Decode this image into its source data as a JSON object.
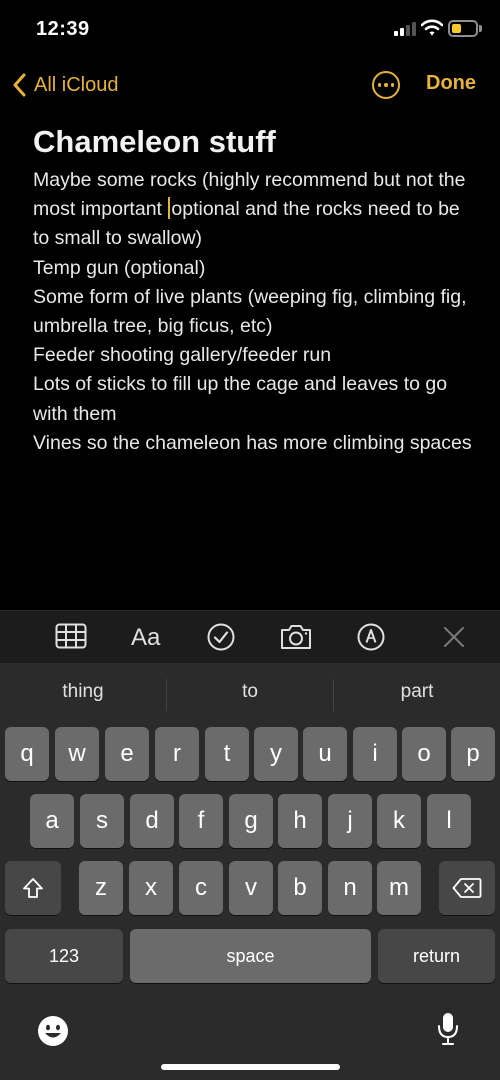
{
  "status": {
    "time": "12:39",
    "battery_level": 0.3
  },
  "nav": {
    "back_label": "All iCloud",
    "done_label": "Done"
  },
  "note": {
    "title": "Chameleon stuff",
    "line1_before_cursor": "Maybe some rocks (highly recommend but not the most important ",
    "line1_after_cursor": "optional and the rocks need to be to small to swallow)",
    "items": [
      "Temp gun (optional)",
      "Some form of live plants (weeping fig, climbing fig, umbrella tree, big ficus, etc)",
      "Feeder shooting gallery/feeder run",
      "Lots of sticks to fill up the cage and leaves to go with them",
      "Vines so the chameleon has more climbing spaces"
    ]
  },
  "toolbar": {
    "format_label": "Aa",
    "icons": [
      "table-icon",
      "format-icon",
      "checklist-icon",
      "camera-icon",
      "markup-icon",
      "close-icon"
    ]
  },
  "keyboard": {
    "suggestions": [
      "thing",
      "to",
      "part"
    ],
    "row1": [
      "q",
      "w",
      "e",
      "r",
      "t",
      "y",
      "u",
      "i",
      "o",
      "p"
    ],
    "row2": [
      "a",
      "s",
      "d",
      "f",
      "g",
      "h",
      "j",
      "k",
      "l"
    ],
    "row3": [
      "z",
      "x",
      "c",
      "v",
      "b",
      "n",
      "m"
    ],
    "numbers_label": "123",
    "space_label": "space",
    "return_label": "return"
  },
  "colors": {
    "accent": "#e5b23b",
    "background": "#000000",
    "key": "#6b6b6b",
    "key_function": "#474747"
  }
}
